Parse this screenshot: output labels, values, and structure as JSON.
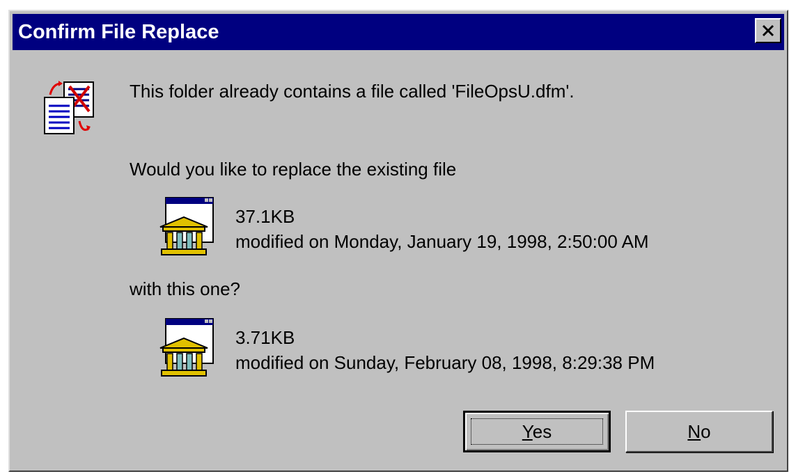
{
  "window": {
    "title": "Confirm File Replace",
    "close_icon": "close-icon"
  },
  "message": {
    "line1": "This folder already contains a file called 'FileOpsU.dfm'.",
    "question": "Would you like to replace the existing file",
    "with_prompt": "with this one?"
  },
  "existing_file": {
    "icon": "application-file-icon",
    "size": "37.1KB",
    "modified": "modified on Monday, January 19, 1998, 2:50:00 AM"
  },
  "new_file": {
    "icon": "application-file-icon",
    "size": "3.71KB",
    "modified": "modified on Sunday, February 08, 1998, 8:29:38 PM"
  },
  "buttons": {
    "yes_mnemonic": "Y",
    "yes_rest": "es",
    "no_mnemonic": "N",
    "no_rest": "o"
  },
  "colors": {
    "titlebar": "#000080",
    "face": "#c0c0c0"
  }
}
